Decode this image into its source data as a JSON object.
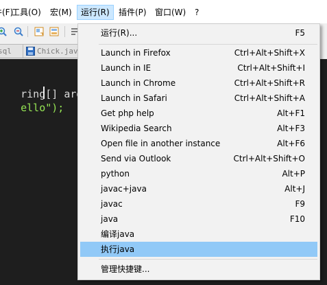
{
  "menubar": {
    "items": [
      {
        "label": "件(F)"
      },
      {
        "label": "工具(O)"
      },
      {
        "label": "宏(M)"
      },
      {
        "label": "运行(R)"
      },
      {
        "label": "插件(P)"
      },
      {
        "label": "窗口(W)"
      },
      {
        "label": "?"
      }
    ]
  },
  "tabs": [
    {
      "label": "sql"
    },
    {
      "label": "Chick.java"
    }
  ],
  "editor": {
    "lines": [
      {
        "text": "ring[] args"
      },
      {
        "text": "ello\");"
      }
    ],
    "colors": {
      "bracket": "#f0c674",
      "string": "#95e454",
      "text": "#dcdcdc",
      "punct": "#cccccc"
    }
  },
  "menu": {
    "items": [
      {
        "label": "运行(R)...",
        "shortcut": "F5"
      },
      {
        "label": "Launch in Firefox",
        "shortcut": "Ctrl+Alt+Shift+X"
      },
      {
        "label": "Launch in IE",
        "shortcut": "Ctrl+Alt+Shift+I"
      },
      {
        "label": "Launch in Chrome",
        "shortcut": "Ctrl+Alt+Shift+R"
      },
      {
        "label": "Launch in Safari",
        "shortcut": "Ctrl+Alt+Shift+A"
      },
      {
        "label": "Get php help",
        "shortcut": "Alt+F1"
      },
      {
        "label": "Wikipedia Search",
        "shortcut": "Alt+F3"
      },
      {
        "label": "Open file in another instance",
        "shortcut": "Alt+F6"
      },
      {
        "label": "Send via Outlook",
        "shortcut": "Ctrl+Alt+Shift+O"
      },
      {
        "label": "python",
        "shortcut": "Alt+P"
      },
      {
        "label": "javac+java",
        "shortcut": "Alt+J"
      },
      {
        "label": "javac",
        "shortcut": "F9"
      },
      {
        "label": "java",
        "shortcut": "F10"
      },
      {
        "label": "编译java",
        "shortcut": ""
      },
      {
        "label": "执行java",
        "shortcut": "",
        "highlighted": true
      },
      {
        "label": "管理快捷键...",
        "shortcut": ""
      }
    ],
    "highlight_color": "#91c9f7"
  }
}
